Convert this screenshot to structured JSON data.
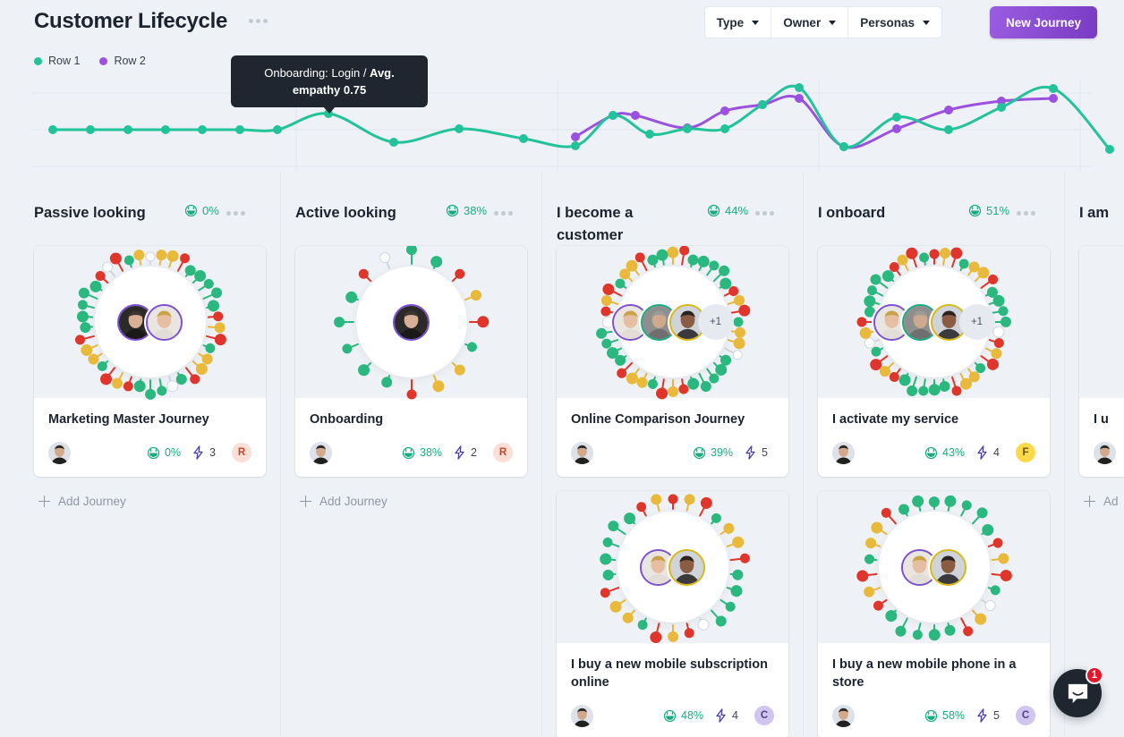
{
  "header": {
    "title": "Customer Lifecycle",
    "more_icon": "ellipsis-icon",
    "filters": [
      {
        "label": "Type"
      },
      {
        "label": "Owner"
      },
      {
        "label": "Personas"
      }
    ],
    "primary_button": "New Journey",
    "accent_color": "#8a4ad6"
  },
  "tooltip": {
    "prefix": "Onboarding: Login / ",
    "strong": "Avg. empathy 0.75"
  },
  "chart_data": {
    "type": "line",
    "title": "",
    "xlabel": "",
    "ylabel": "",
    "grid": true,
    "legend_position": "top-left",
    "ylim": [
      0,
      1
    ],
    "colors": {
      "Row 1": "#22c39a",
      "Row 2": "#9b51e0"
    },
    "series": [
      {
        "name": "Row 1",
        "color": "#22c39a",
        "points": [
          [
            59,
            145
          ],
          [
            101,
            145
          ],
          [
            143,
            145
          ],
          [
            185,
            145
          ],
          [
            226,
            145
          ],
          [
            268,
            145
          ],
          [
            310,
            145
          ],
          [
            367,
            127
          ],
          [
            440,
            159
          ],
          [
            513,
            144
          ],
          [
            585,
            155
          ],
          [
            643,
            163
          ],
          [
            685,
            129
          ],
          [
            726,
            150
          ],
          [
            768,
            144
          ],
          [
            810,
            144
          ],
          [
            852,
            117
          ],
          [
            893,
            98
          ],
          [
            943,
            164
          ],
          [
            1002,
            131
          ],
          [
            1060,
            145
          ],
          [
            1119,
            120
          ],
          [
            1177,
            99
          ],
          [
            1240,
            167
          ]
        ]
      },
      {
        "name": "Row 2",
        "color": "#9b51e0",
        "points": [
          [
            643,
            153
          ],
          [
            685,
            129
          ],
          [
            710,
            129
          ],
          [
            768,
            143
          ],
          [
            810,
            124
          ],
          [
            852,
            117
          ],
          [
            893,
            110
          ],
          [
            943,
            164
          ],
          [
            1002,
            144
          ],
          [
            1060,
            123
          ],
          [
            1119,
            113
          ],
          [
            1177,
            110
          ]
        ]
      }
    ]
  },
  "columns": [
    {
      "title": "Passive looking",
      "score": "0%",
      "score_icon": "smiley-icon",
      "more_icon": "ellipsis-icon",
      "add_label": "Add Journey",
      "cards": [
        {
          "title": "Marketing Master Journey",
          "empathy": "0%",
          "steps": "3",
          "badge": "R",
          "badge_color": "red",
          "avatars": [
            {
              "ring": "purple",
              "person": "man-dark"
            },
            {
              "ring": "purple",
              "person": "man-blond"
            }
          ],
          "extra": "",
          "pin_count": 38
        }
      ]
    },
    {
      "title": "Active looking",
      "score": "38%",
      "score_icon": "smiley-icon",
      "more_icon": "ellipsis-icon",
      "add_label": "Add Journey",
      "cards": [
        {
          "title": "Onboarding",
          "empathy": "38%",
          "steps": "2",
          "badge": "R",
          "badge_color": "red",
          "avatars": [
            {
              "ring": "purple",
              "person": "man-dark"
            }
          ],
          "extra": "",
          "pin_count": 16
        }
      ]
    },
    {
      "title": "I become a customer",
      "score": "44%",
      "score_icon": "smiley-icon",
      "more_icon": "ellipsis-icon",
      "add_label": "",
      "cards": [
        {
          "title": "Online Comparison Journey",
          "empathy": "39%",
          "steps": "5",
          "badge": "",
          "badge_color": "",
          "avatars": [
            {
              "ring": "purple",
              "person": "man-blond"
            },
            {
              "ring": "green",
              "person": "man-grey"
            },
            {
              "ring": "yellow",
              "person": "woman-dark"
            }
          ],
          "extra": "+1",
          "pin_count": 40
        },
        {
          "title": "I buy a new mobile subscription online",
          "empathy": "48%",
          "steps": "4",
          "badge": "C",
          "badge_color": "purple",
          "avatars": [
            {
              "ring": "purple",
              "person": "man-blond"
            },
            {
              "ring": "yellow",
              "person": "woman-dark"
            }
          ],
          "extra": "",
          "pin_count": 26
        }
      ]
    },
    {
      "title": "I onboard",
      "score": "51%",
      "score_icon": "smiley-icon",
      "more_icon": "ellipsis-icon",
      "add_label": "",
      "cards": [
        {
          "title": "I activate my service",
          "empathy": "43%",
          "steps": "4",
          "badge": "F",
          "badge_color": "yellow",
          "avatars": [
            {
              "ring": "purple",
              "person": "man-blond"
            },
            {
              "ring": "green",
              "person": "man-grey"
            },
            {
              "ring": "yellow",
              "person": "woman-dark"
            }
          ],
          "extra": "+1",
          "pin_count": 40
        },
        {
          "title": "I buy a new mobile phone in a store",
          "empathy": "58%",
          "steps": "5",
          "badge": "C",
          "badge_color": "purple",
          "avatars": [
            {
              "ring": "purple",
              "person": "man-blond"
            },
            {
              "ring": "yellow",
              "person": "woman-dark"
            }
          ],
          "extra": "",
          "pin_count": 26
        }
      ]
    },
    {
      "title": "I am",
      "score": "",
      "score_icon": "",
      "more_icon": "",
      "add_label": "Ad",
      "cards": [
        {
          "title": "I u",
          "empathy": "",
          "steps": "",
          "badge": "",
          "badge_color": "",
          "avatars": [],
          "extra": "",
          "pin_count": 0
        }
      ]
    }
  ],
  "intercom": {
    "unread": "1",
    "icon": "chat-bubble-icon"
  }
}
